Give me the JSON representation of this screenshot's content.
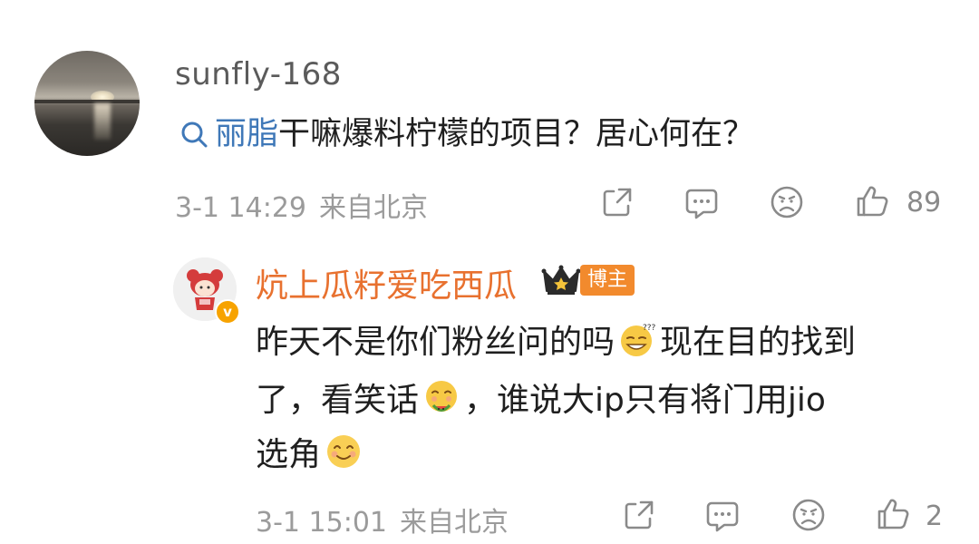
{
  "main_comment": {
    "username": "sunfly-168",
    "topic_link": "丽脂",
    "text": "干嘛爆料柠檬的项目？居心何在？",
    "time": "3-1 14:29",
    "location": "来自北京",
    "like_count": "89",
    "icons": [
      "search-icon",
      "share-icon",
      "comment-icon",
      "dislike-icon",
      "like-icon"
    ]
  },
  "reply": {
    "username": "炕上瓜籽爱吃西瓜",
    "badge": "博主",
    "line1_a": "昨天不是你们粉丝问的吗",
    "line1_b": "现在目的找到",
    "line2_a": "了，看笑话",
    "line2_b": "，谁说大ip只有将门用jio",
    "line3": "选角",
    "time": "3-1 15:01",
    "location": "来自北京",
    "like_count": "2",
    "verified_mark": "v",
    "emojis": [
      "sleepy-grin-emoji",
      "eating-watermelon-emoji",
      "smile-emoji"
    ]
  },
  "colors": {
    "username_main": "#5b5b5b",
    "username_reply": "#e8712f",
    "topic_link": "#3f78b8",
    "badge_bg": "#f28a2d",
    "meta_gray": "#9b9b9b",
    "icon_gray": "#8a8a8a"
  }
}
